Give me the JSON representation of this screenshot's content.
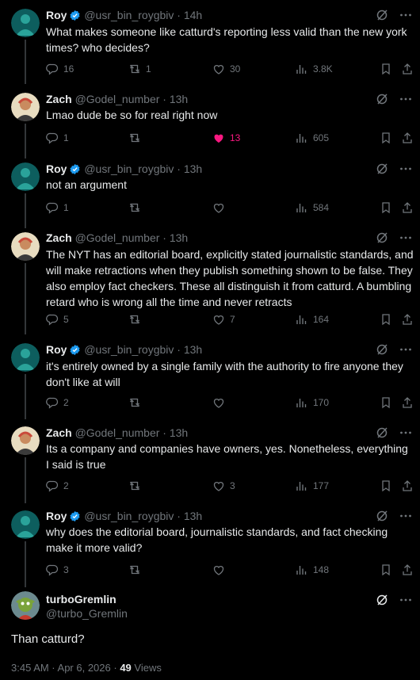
{
  "tweets": [
    {
      "author": "Roy",
      "handle": "@usr_bin_roygbiv",
      "time": "14h",
      "verified": true,
      "text": "What makes someone like catturd's reporting less valid than the new york times? who decides?",
      "replies": "16",
      "reposts": "1",
      "likes": "30",
      "views": "3.8K",
      "liked": false
    },
    {
      "author": "Zach",
      "handle": "@Godel_number",
      "time": "13h",
      "verified": false,
      "text": "Lmao dude be so for real right now",
      "replies": "1",
      "reposts": "",
      "likes": "13",
      "views": "605",
      "liked": true
    },
    {
      "author": "Roy",
      "handle": "@usr_bin_roygbiv",
      "time": "13h",
      "verified": true,
      "text": "not an argument",
      "replies": "1",
      "reposts": "",
      "likes": "",
      "views": "584",
      "liked": false
    },
    {
      "author": "Zach",
      "handle": "@Godel_number",
      "time": "13h",
      "verified": false,
      "text": "The NYT has an editorial board, explicitly stated journalistic standards, and will make retractions when they publish something shown to be false. They also employ fact checkers. These all distinguish it from catturd. A bumbling retard who is wrong all the time and never retracts",
      "replies": "5",
      "reposts": "",
      "likes": "7",
      "views": "164",
      "liked": false
    },
    {
      "author": "Roy",
      "handle": "@usr_bin_roygbiv",
      "time": "13h",
      "verified": true,
      "text": "it's entirely owned by a single family with the authority to fire anyone they don't like at will",
      "replies": "2",
      "reposts": "",
      "likes": "",
      "views": "170",
      "liked": false
    },
    {
      "author": "Zach",
      "handle": "@Godel_number",
      "time": "13h",
      "verified": false,
      "text": "Its a company and companies have owners, yes. Nonetheless, everything I said is true",
      "replies": "2",
      "reposts": "",
      "likes": "3",
      "views": "177",
      "liked": false
    },
    {
      "author": "Roy",
      "handle": "@usr_bin_roygbiv",
      "time": "13h",
      "verified": true,
      "text": "why does the editorial board, journalistic standards, and fact checking make it more valid?",
      "replies": "3",
      "reposts": "",
      "likes": "",
      "views": "148",
      "liked": false
    }
  ],
  "main_tweet": {
    "author": "turboGremlin",
    "handle": "@turbo_Gremlin",
    "text": "Than catturd?",
    "timestamp": "3:45 AM · Apr 6, 2026 · ",
    "views_count": "49",
    "views_label": "Views"
  },
  "separator": "·",
  "colors": {
    "like": "#f91880",
    "verified": "#1d9bf0",
    "muted": "#71767b"
  }
}
